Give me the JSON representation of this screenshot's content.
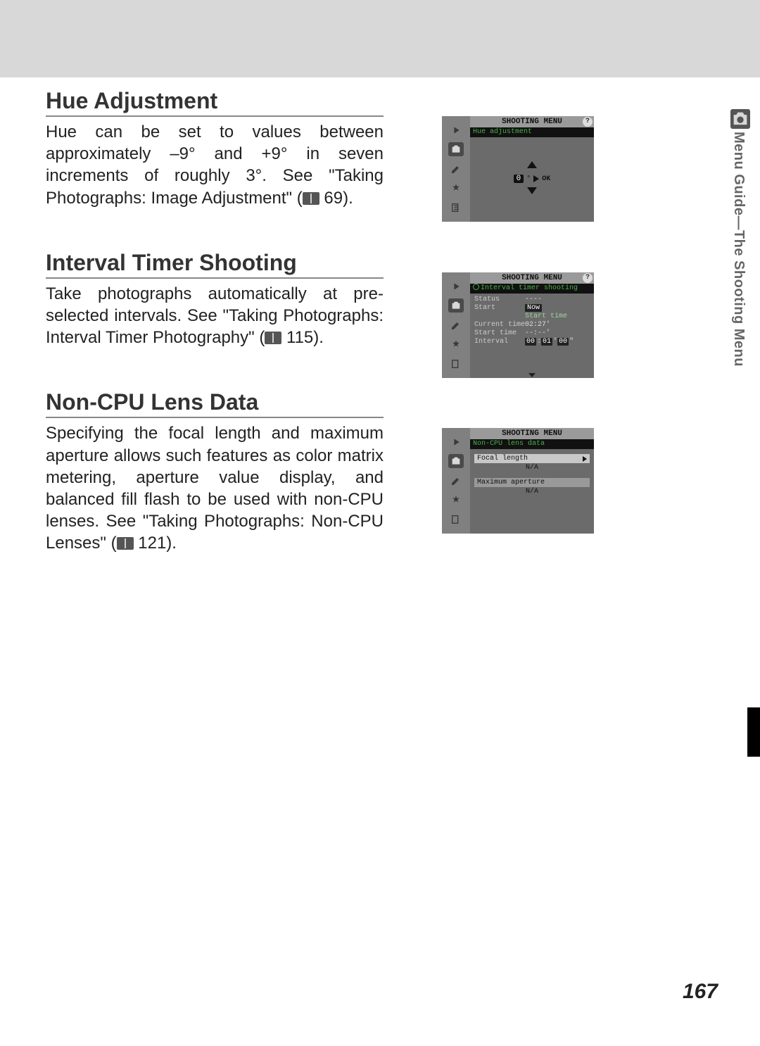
{
  "sideTab": "Menu Guide—The Shooting Menu",
  "pageNumber": "167",
  "sections": {
    "hue": {
      "title": "Hue Adjustment",
      "body_pre": "Hue can be set to values between approximately –9° and +9° in seven increments of roughly 3°. See \"Taking Photographs: Image Adjustment\" (",
      "page_ref": " 69)."
    },
    "interval": {
      "title": "Interval Timer Shooting",
      "body_pre": "Take photographs automatically at pre-selected intervals. See \"Taking Photographs: Interval Timer Photography\" (",
      "page_ref": " 115)."
    },
    "noncpu": {
      "title": "Non-CPU Lens Data",
      "body_pre": "Specifying the focal length and maximum aperture allows such features as color matrix metering, aperture value display, and balanced fill flash to be used with non-CPU lenses. See \"Taking Photographs: Non-CPU Lenses\" (",
      "page_ref": " 121)."
    }
  },
  "screens": {
    "shootingMenuTitle": "SHOOTING MENU",
    "hue": {
      "subtitle": "Hue adjustment",
      "value": "0",
      "ok": "OK"
    },
    "interval": {
      "subtitle": "Interval timer shooting",
      "rows": {
        "status_label": "Status",
        "status_value": "----",
        "start_label": "Start",
        "start_now": "Now",
        "start_time_label_alt": "Start time",
        "current_time_label": "Current time",
        "current_time_value": "02:27'",
        "start_time_label": "Start time",
        "start_time_value": "--:--'",
        "interval_label": "Interval",
        "interval_h": "00",
        "interval_m": "01",
        "interval_s": "00"
      }
    },
    "noncpu": {
      "subtitle": "Non-CPU lens data",
      "focal_length_label": "Focal length",
      "focal_length_value": "N/A",
      "max_aperture_label": "Maximum aperture",
      "max_aperture_value": "N/A"
    }
  }
}
